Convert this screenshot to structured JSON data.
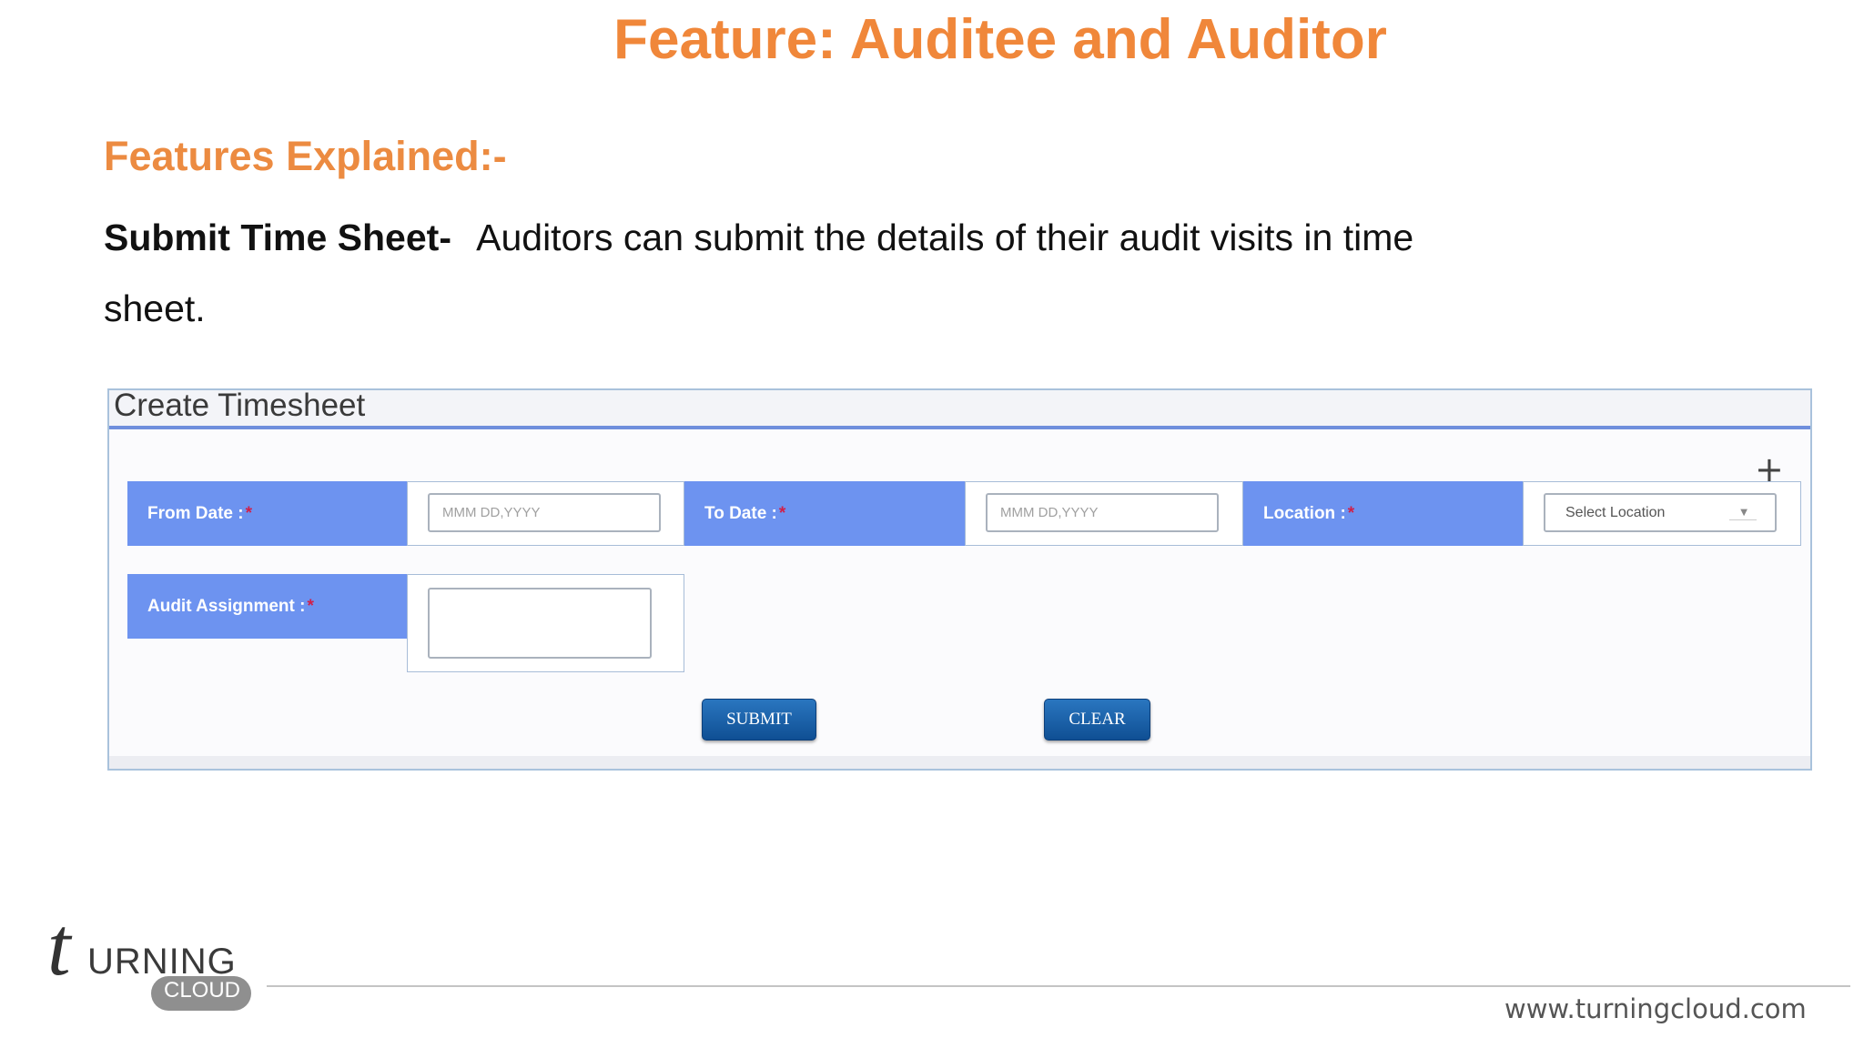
{
  "slide": {
    "title": "Feature: Auditee and Auditor",
    "section_heading": "Features Explained:-",
    "feature_term": "Submit Time Sheet-",
    "feature_description": "Auditors can submit the details of their audit visits in time sheet."
  },
  "form": {
    "title": "Create Timesheet",
    "add_icon": "plus-icon",
    "fields": {
      "from_date": {
        "label": "From Date :",
        "required_mark": "*",
        "placeholder": "MMM DD,YYYY"
      },
      "to_date": {
        "label": "To Date :",
        "required_mark": "*",
        "placeholder": "MMM DD,YYYY"
      },
      "location": {
        "label": "Location :",
        "required_mark": "*",
        "selected": "Select Location"
      },
      "audit_assignment": {
        "label": "Audit Assignment :",
        "required_mark": "*",
        "value": ""
      }
    },
    "buttons": {
      "submit": "SUBMIT",
      "clear": "CLEAR"
    }
  },
  "footer": {
    "logo_letter": "t",
    "logo_word": "URNING",
    "logo_cloud": "CLOUD",
    "url": "www.turningcloud.com"
  },
  "colors": {
    "title_orange": "#f0873a",
    "label_blue": "#6d93f0",
    "button_blue": "#1a5fa8"
  }
}
